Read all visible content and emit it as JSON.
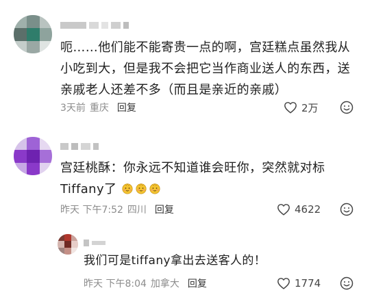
{
  "comments": [
    {
      "text_lines": [
        "呃……他们能不能寄贵一点的啊，宫廷糕点虽然我从",
        "小吃到大，但是我不会把它当作商业送人的东西，送",
        "亲戚老人还差不多（而且是亲近的亲戚）"
      ],
      "time": "3天前",
      "location": "重庆",
      "reply_label": "回复",
      "likes": "2万"
    },
    {
      "text_lines": [
        "宫廷桃酥：你永远不知道谁会旺你，突然就对标",
        "Tiffany了"
      ],
      "emoji_count": 3,
      "time": "昨天 下午7:52",
      "location": "四川",
      "reply_label": "回复",
      "likes": "4622"
    },
    {
      "text_lines": [
        "我们可是tiffany拿出去送客人的！"
      ],
      "time": "昨天 下午8:04",
      "location": "加拿大",
      "reply_label": "回复",
      "likes": "1774"
    }
  ],
  "icons": {
    "like": "heart-outline-icon",
    "comment_emoji": "smiley-face-icon",
    "inline_emoji": "smiling-face-emoji",
    "avatar": "blurred-avatar"
  },
  "colors": {
    "text": "#202020",
    "meta": "#8c8c8c",
    "avatar1": "#2f7d6b",
    "avatar2": "#8a39c9",
    "avatar3": "#b0362c"
  }
}
